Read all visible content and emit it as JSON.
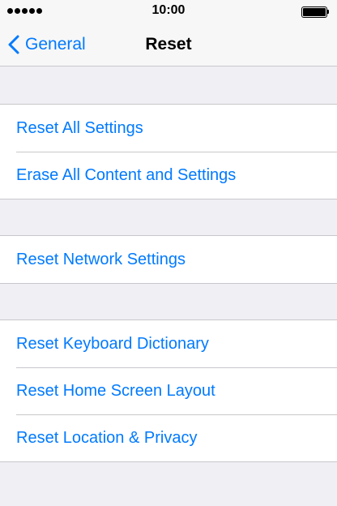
{
  "status_bar": {
    "time": "10:00",
    "signal_bars": 5
  },
  "nav": {
    "back_label": "General",
    "title": "Reset"
  },
  "groups": [
    {
      "items": [
        {
          "label": "Reset All Settings"
        },
        {
          "label": "Erase All Content and Settings"
        }
      ]
    },
    {
      "items": [
        {
          "label": "Reset Network Settings"
        }
      ]
    },
    {
      "items": [
        {
          "label": "Reset Keyboard Dictionary"
        },
        {
          "label": "Reset Home Screen Layout"
        },
        {
          "label": "Reset Location & Privacy"
        }
      ]
    }
  ],
  "colors": {
    "accent": "#007aff",
    "background": "#efeff4",
    "separator": "#c8c7cc"
  },
  "icons": [
    "signal-dots-icon",
    "battery-icon",
    "chevron-left-icon"
  ]
}
